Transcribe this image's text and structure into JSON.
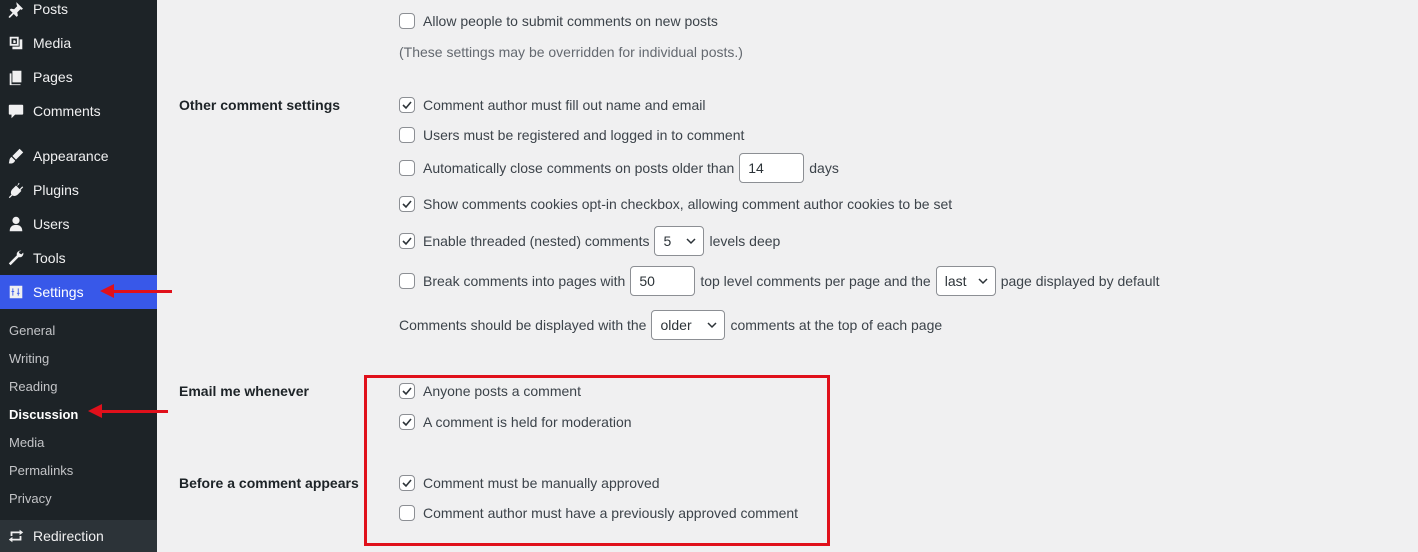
{
  "sidebar": {
    "items": [
      {
        "label": "Posts",
        "icon": "pin-icon"
      },
      {
        "label": "Media",
        "icon": "media-icon"
      },
      {
        "label": "Pages",
        "icon": "pages-icon"
      },
      {
        "label": "Comments",
        "icon": "comment-icon"
      },
      {
        "label": "Appearance",
        "icon": "brush-icon"
      },
      {
        "label": "Plugins",
        "icon": "plugin-icon"
      },
      {
        "label": "Users",
        "icon": "user-icon"
      },
      {
        "label": "Tools",
        "icon": "wrench-icon"
      },
      {
        "label": "Settings",
        "icon": "settings-icon"
      }
    ],
    "submenu": [
      "General",
      "Writing",
      "Reading",
      "Discussion",
      "Media",
      "Permalinks",
      "Privacy"
    ],
    "bottom": {
      "label": "Redirection",
      "icon": "redirect-icon"
    },
    "accent_color": "#3858e9"
  },
  "discussion": {
    "allow_new_posts": {
      "label": "Allow people to submit comments on new posts",
      "checked": false
    },
    "override_note": "(These settings may be overridden for individual posts.)",
    "other_settings": {
      "heading": "Other comment settings",
      "require_name_email": {
        "label": "Comment author must fill out name and email",
        "checked": true
      },
      "registered_only": {
        "label": "Users must be registered and logged in to comment",
        "checked": false
      },
      "auto_close": {
        "label": "Automatically close comments on posts older than",
        "checked": false,
        "value": "14",
        "suffix": "days"
      },
      "cookies_optin": {
        "label": "Show comments cookies opt-in checkbox, allowing comment author cookies to be set",
        "checked": true
      },
      "threaded": {
        "label": "Enable threaded (nested) comments",
        "checked": true,
        "value": "5",
        "suffix": "levels deep"
      },
      "paged": {
        "label": "Break comments into pages with",
        "checked": false,
        "value": "50",
        "middle": "top level comments per page and the",
        "select": "last",
        "suffix": "page displayed by default"
      },
      "order": {
        "prefix": "Comments should be displayed with the",
        "select": "older",
        "suffix": "comments at the top of each page"
      }
    },
    "email": {
      "heading": "Email me whenever",
      "anyone_posts": {
        "label": "Anyone posts a comment",
        "checked": true
      },
      "held_moderation": {
        "label": "A comment is held for moderation",
        "checked": true
      }
    },
    "before_appears": {
      "heading": "Before a comment appears",
      "manual_approve": {
        "label": "Comment must be manually approved",
        "checked": true
      },
      "prev_approved": {
        "label": "Comment author must have a previously approved comment",
        "checked": false
      }
    }
  },
  "annotation_color": "#e0101b"
}
